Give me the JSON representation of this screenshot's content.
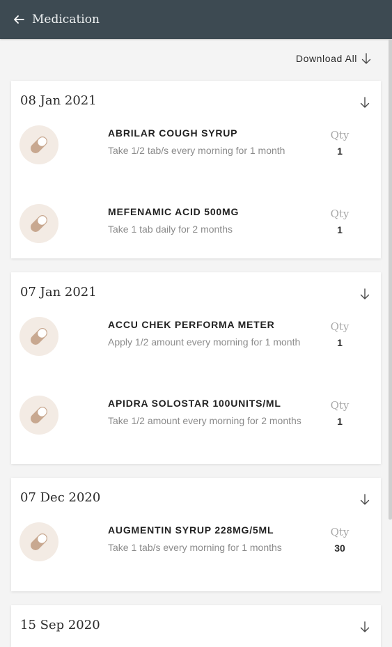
{
  "header": {
    "title": "Medication"
  },
  "toolbar": {
    "download_all_label": "Download All"
  },
  "qty_label": "Qty",
  "groups": [
    {
      "date": "08 Jan 2021",
      "items": [
        {
          "name": "ABRILAR COUGH SYRUP",
          "instructions": "Take 1/2 tab/s every morning for 1 month",
          "qty": "1"
        },
        {
          "name": "MEFENAMIC ACID 500MG",
          "instructions": "Take 1 tab daily for 2 months",
          "qty": "1"
        }
      ]
    },
    {
      "date": "07 Jan 2021",
      "items": [
        {
          "name": "ACCU CHEK PERFORMA METER",
          "instructions": "Apply 1/2 amount every morning for 1 month",
          "qty": "1"
        },
        {
          "name": "APIDRA SOLOSTAR 100UNITS/ML",
          "instructions": "Take 1/2 amount every morning for 2 months",
          "qty": "1"
        }
      ]
    },
    {
      "date": "07 Dec 2020",
      "items": [
        {
          "name": "AUGMENTIN SYRUP 228MG/5ML",
          "instructions": "Take 1 tab/s every morning for 1 months",
          "qty": "30"
        }
      ]
    },
    {
      "date": "15 Sep 2020",
      "items": []
    }
  ],
  "colors": {
    "appbar": "#3d4a52",
    "pill_bg": "#f3ebe4",
    "pill_icon": "#c8a890"
  },
  "icons": {
    "back": "arrow-left-icon",
    "download": "arrow-down-icon",
    "medication": "capsule-icon"
  }
}
